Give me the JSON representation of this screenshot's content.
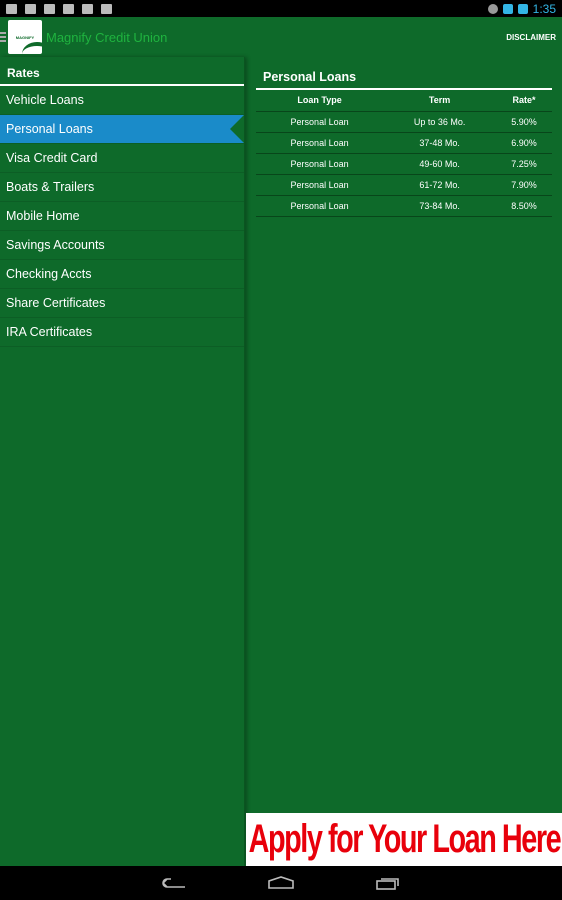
{
  "status_bar": {
    "time": "1:35",
    "icons": [
      "gmail-icon",
      "photos-icon",
      "download-icon",
      "android-icon",
      "task-icon",
      "play-store-icon"
    ]
  },
  "action_bar": {
    "app_title": "Magnify Credit Union",
    "logo_text": "MAGNIFY",
    "disclaimer_label": "DISCLAIMER"
  },
  "sidebar": {
    "header": "Rates",
    "items": [
      {
        "label": "Vehicle Loans"
      },
      {
        "label": "Personal Loans",
        "selected": true
      },
      {
        "label": "Visa Credit Card"
      },
      {
        "label": "Boats & Trailers"
      },
      {
        "label": "Mobile Home"
      },
      {
        "label": "Savings Accounts"
      },
      {
        "label": "Checking Accts"
      },
      {
        "label": "Share Certificates"
      },
      {
        "label": "IRA Certificates"
      }
    ]
  },
  "main": {
    "title": "Personal Loans",
    "columns": [
      "Loan Type",
      "Term",
      "Rate*"
    ],
    "rows": [
      [
        "Personal Loan",
        "Up to 36 Mo.",
        "5.90%"
      ],
      [
        "Personal Loan",
        "37-48 Mo.",
        "6.90%"
      ],
      [
        "Personal Loan",
        "49-60 Mo.",
        "7.25%"
      ],
      [
        "Personal Loan",
        "61-72 Mo.",
        "7.90%"
      ],
      [
        "Personal Loan",
        "73-84 Mo.",
        "8.50%"
      ]
    ]
  },
  "banner": {
    "text": "Apply for Your Loan Here"
  },
  "colors": {
    "background": "#0e6a2a",
    "selected": "#1a8bc9",
    "banner_text": "#e8000b",
    "title": "#1fb33f"
  }
}
